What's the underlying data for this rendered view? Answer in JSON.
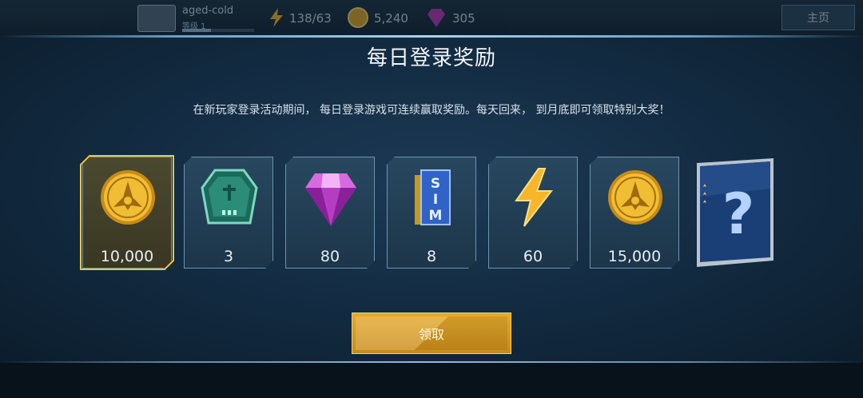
{
  "topbar": {
    "player_name": "aged-cold",
    "level_label": "等级 1",
    "energy": "138/63",
    "coins": "5,240",
    "gems": "305",
    "home_label": "主页"
  },
  "modal": {
    "title": "每日登录奖励",
    "description": "在新玩家登录活动期间，  每日登录游戏可连续赢取奖励。每天回来，  到月底即可领取特别大奖！",
    "claim_label": "领取"
  },
  "rewards": [
    {
      "icon": "gold-coin-icon",
      "quantity": "10,000",
      "highlighted": true
    },
    {
      "icon": "green-shard-icon",
      "quantity": "3",
      "highlighted": false
    },
    {
      "icon": "purple-gem-icon",
      "quantity": "80",
      "highlighted": false
    },
    {
      "icon": "sim-card-icon",
      "quantity": "8",
      "highlighted": false
    },
    {
      "icon": "energy-bolt-icon",
      "quantity": "60",
      "highlighted": false
    },
    {
      "icon": "gold-coin-icon",
      "quantity": "15,000",
      "highlighted": false
    },
    {
      "icon": "mystery-box-icon",
      "quantity": "",
      "highlighted": false
    }
  ],
  "colors": {
    "highlight": "#f0c540",
    "card_border": "#6f93ae",
    "button": "#d99d24"
  }
}
